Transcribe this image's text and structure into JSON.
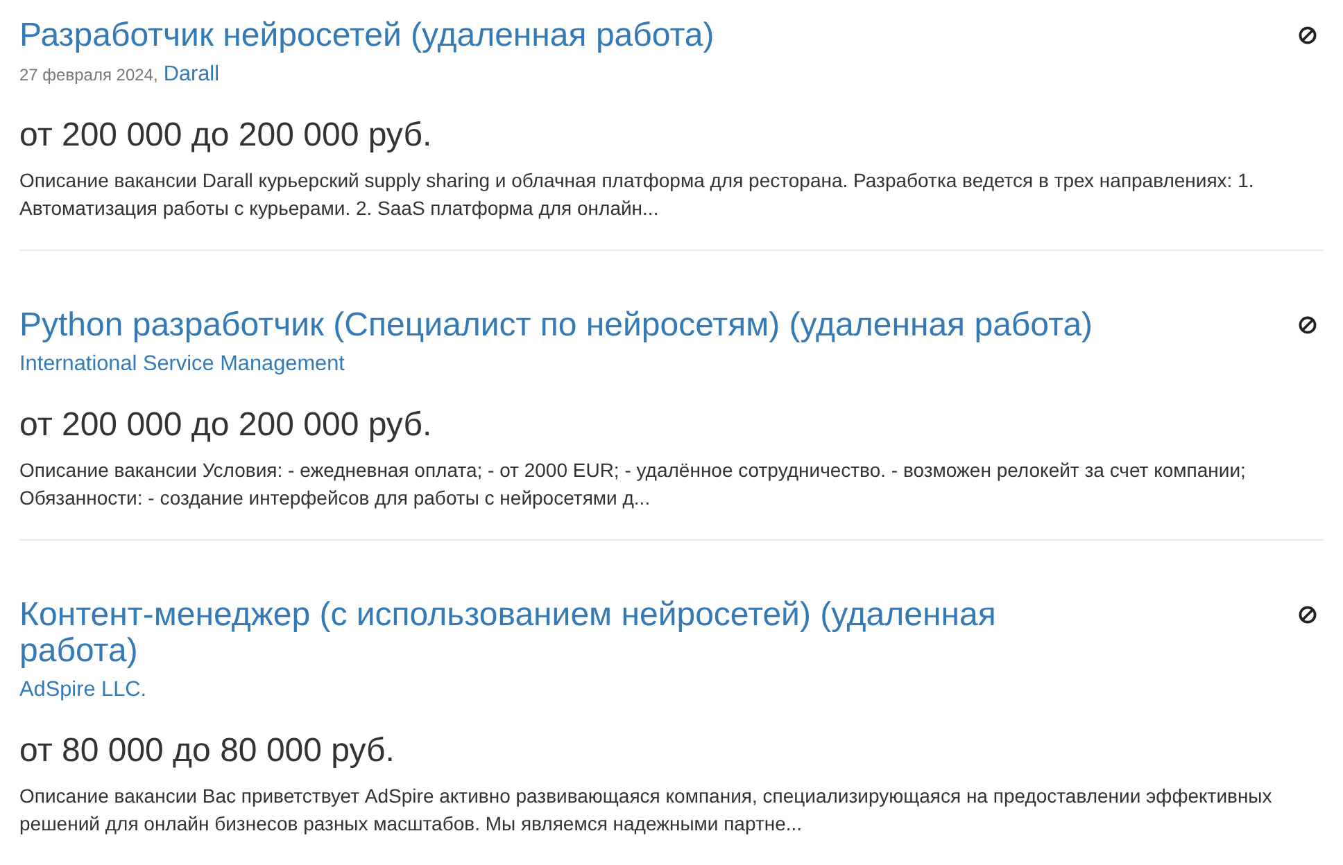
{
  "vacancies": [
    {
      "title": "Разработчик нейросетей (удаленная работа)",
      "date": "27 февраля 2024,",
      "company": "Darall",
      "salary": "от 200 000 до 200 000 руб.",
      "description": "Описание вакансии Darall курьерский supply sharing и облачная платформа для ресторана. Разработка ведется в трех направлениях: 1. Автоматизация работы с курьерами. 2. SaaS платформа для онлайн..."
    },
    {
      "title": "Python разработчик (Специалист по нейросетям) (удаленная работа)",
      "company": "International Service Management",
      "salary": "от 200 000 до 200 000 руб.",
      "description": "Описание вакансии Условия: - ежедневная оплата; - от 2000 EUR; - удалённое сотрудничество. - возможен релокейт за счет компании; Обязанности: - создание интерфейсов для работы с нейросетями д..."
    },
    {
      "title": "Контент-менеджер (с использованием нейросетей) (удаленная работа)",
      "company": "AdSpire LLC.",
      "salary": "от 80 000 до 80 000 руб.",
      "description": "Описание вакансии Вас приветствует AdSpire активно развивающаяся компания, специализирующаяся на предоставлении эффективных решений для онлайн бизнесов разных масштабов. Мы являемся надежными партне..."
    }
  ]
}
